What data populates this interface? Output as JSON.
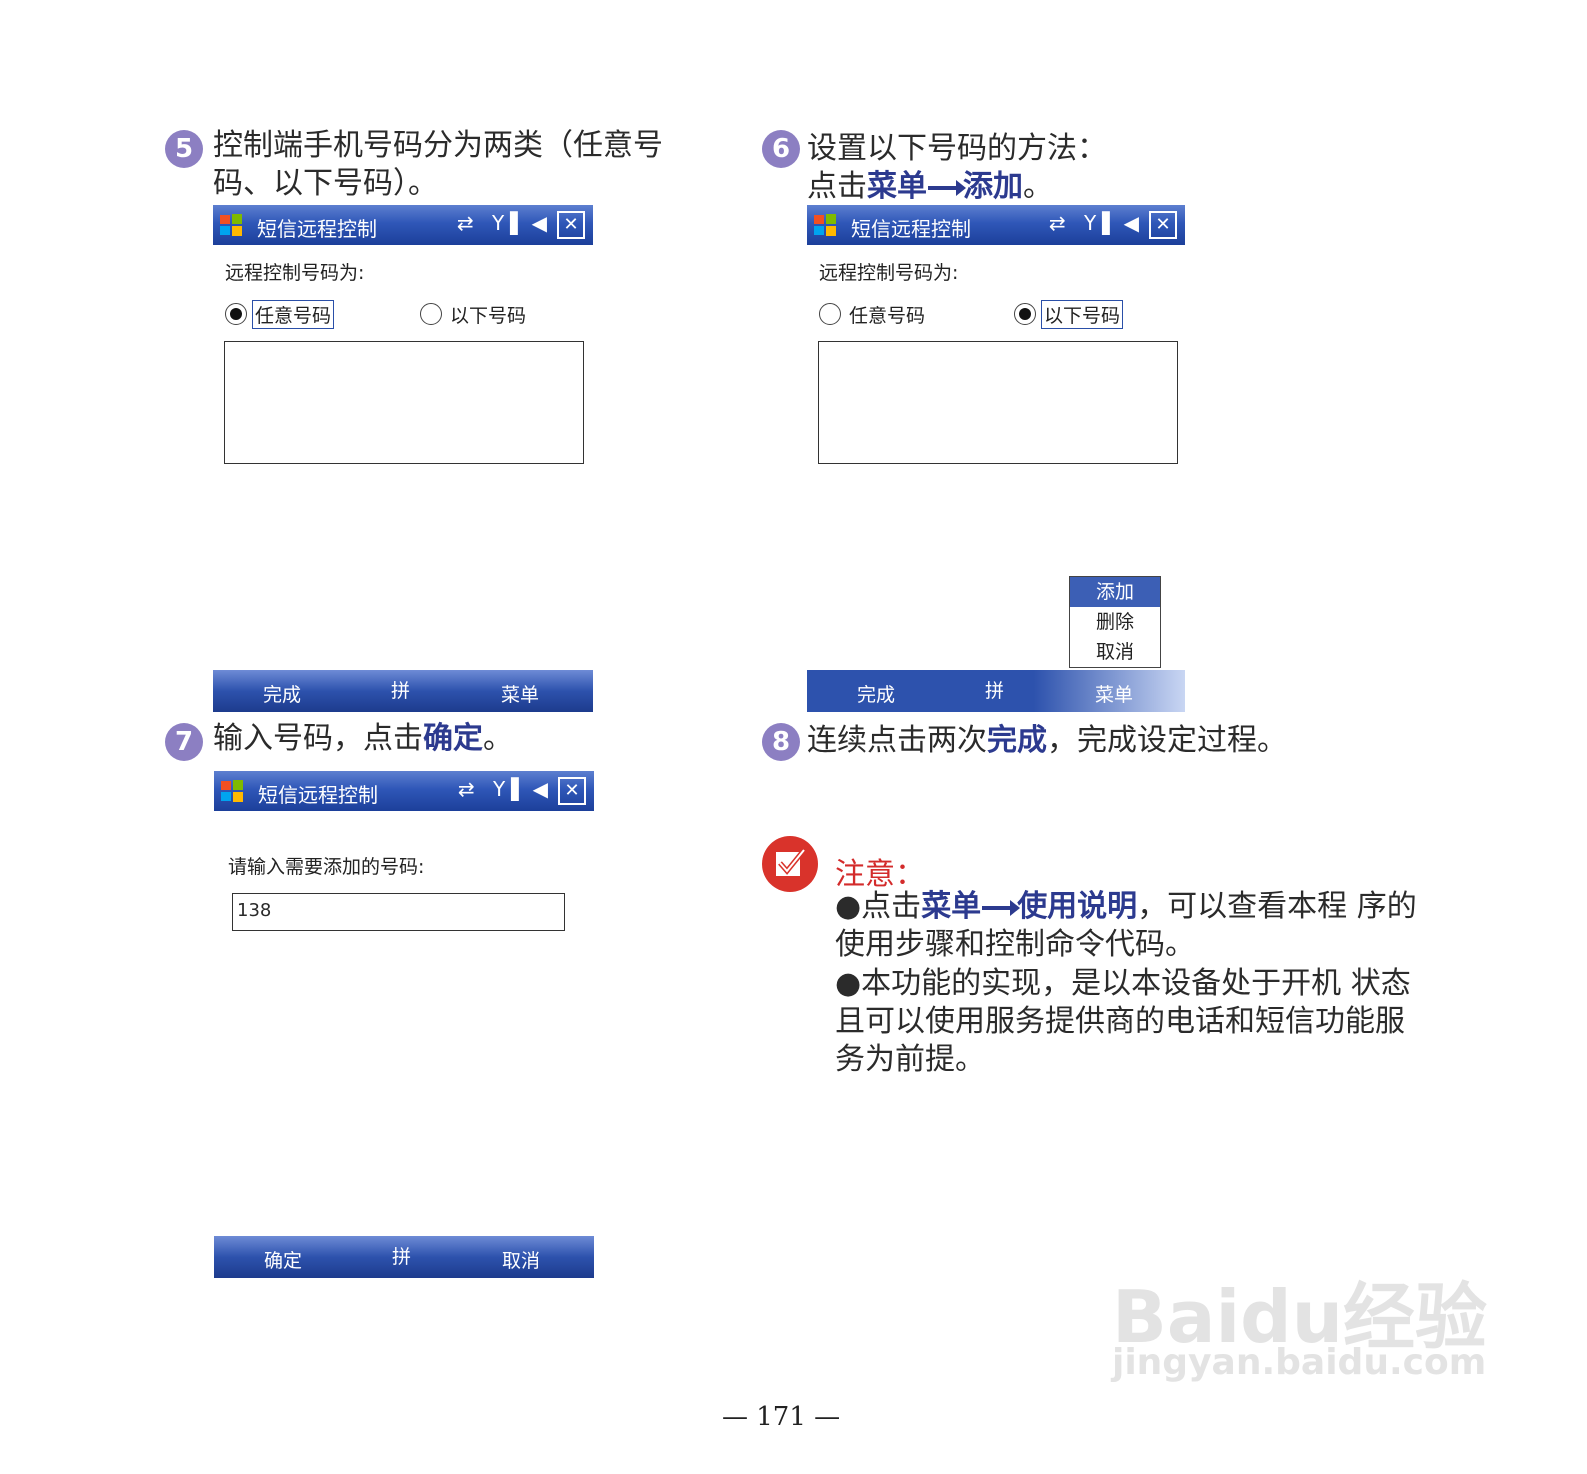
{
  "steps": [
    {
      "num": "5",
      "line1": "控制端手机号码分为两类（任意号",
      "line2": "码、以下号码）。"
    },
    {
      "num": "6",
      "line1": "设置以下号码的方法：",
      "line2_pre": "点击",
      "line2_kw1": "菜单",
      "line2_kw2": "添加",
      "line2_post": "。"
    },
    {
      "num": "7",
      "pre": "输入号码，点击",
      "kw": "确定",
      "post": "。"
    },
    {
      "num": "8",
      "pre": "连续点击两次",
      "kw": "完成",
      "post": "，完成设定过程。"
    }
  ],
  "screen": {
    "title": "短信远程控制",
    "status_icons": "⇄ Y▌◀",
    "close": "✕",
    "remote_label": "远程控制号码为:",
    "radio_any": "任意号码",
    "radio_below": "以下号码",
    "soft_done": "完成",
    "soft_ime": "拼",
    "soft_menu": "菜单",
    "menu_items": [
      "添加",
      "删除",
      "取消"
    ],
    "input_prompt": "请输入需要添加的号码:",
    "input_value": "138",
    "soft_ok": "确定",
    "soft_cancel": "取消"
  },
  "note": {
    "title": "注意：",
    "b1_pre": "●点击",
    "b1_kw1": "菜单",
    "b1_kw2": "使用说明",
    "b1_post": "，可以查看本程 序的使用步骤和控制命令代码。",
    "b2": "●本功能的实现，是以本设备处于开机 状态且可以使用服务提供商的电话和短信功能服务为前提。"
  },
  "page_number": "— 171 —",
  "watermark": {
    "brand": "Bai",
    "brand2": "du",
    "jy": "经验",
    "url": "jingyan.baidu.com"
  }
}
